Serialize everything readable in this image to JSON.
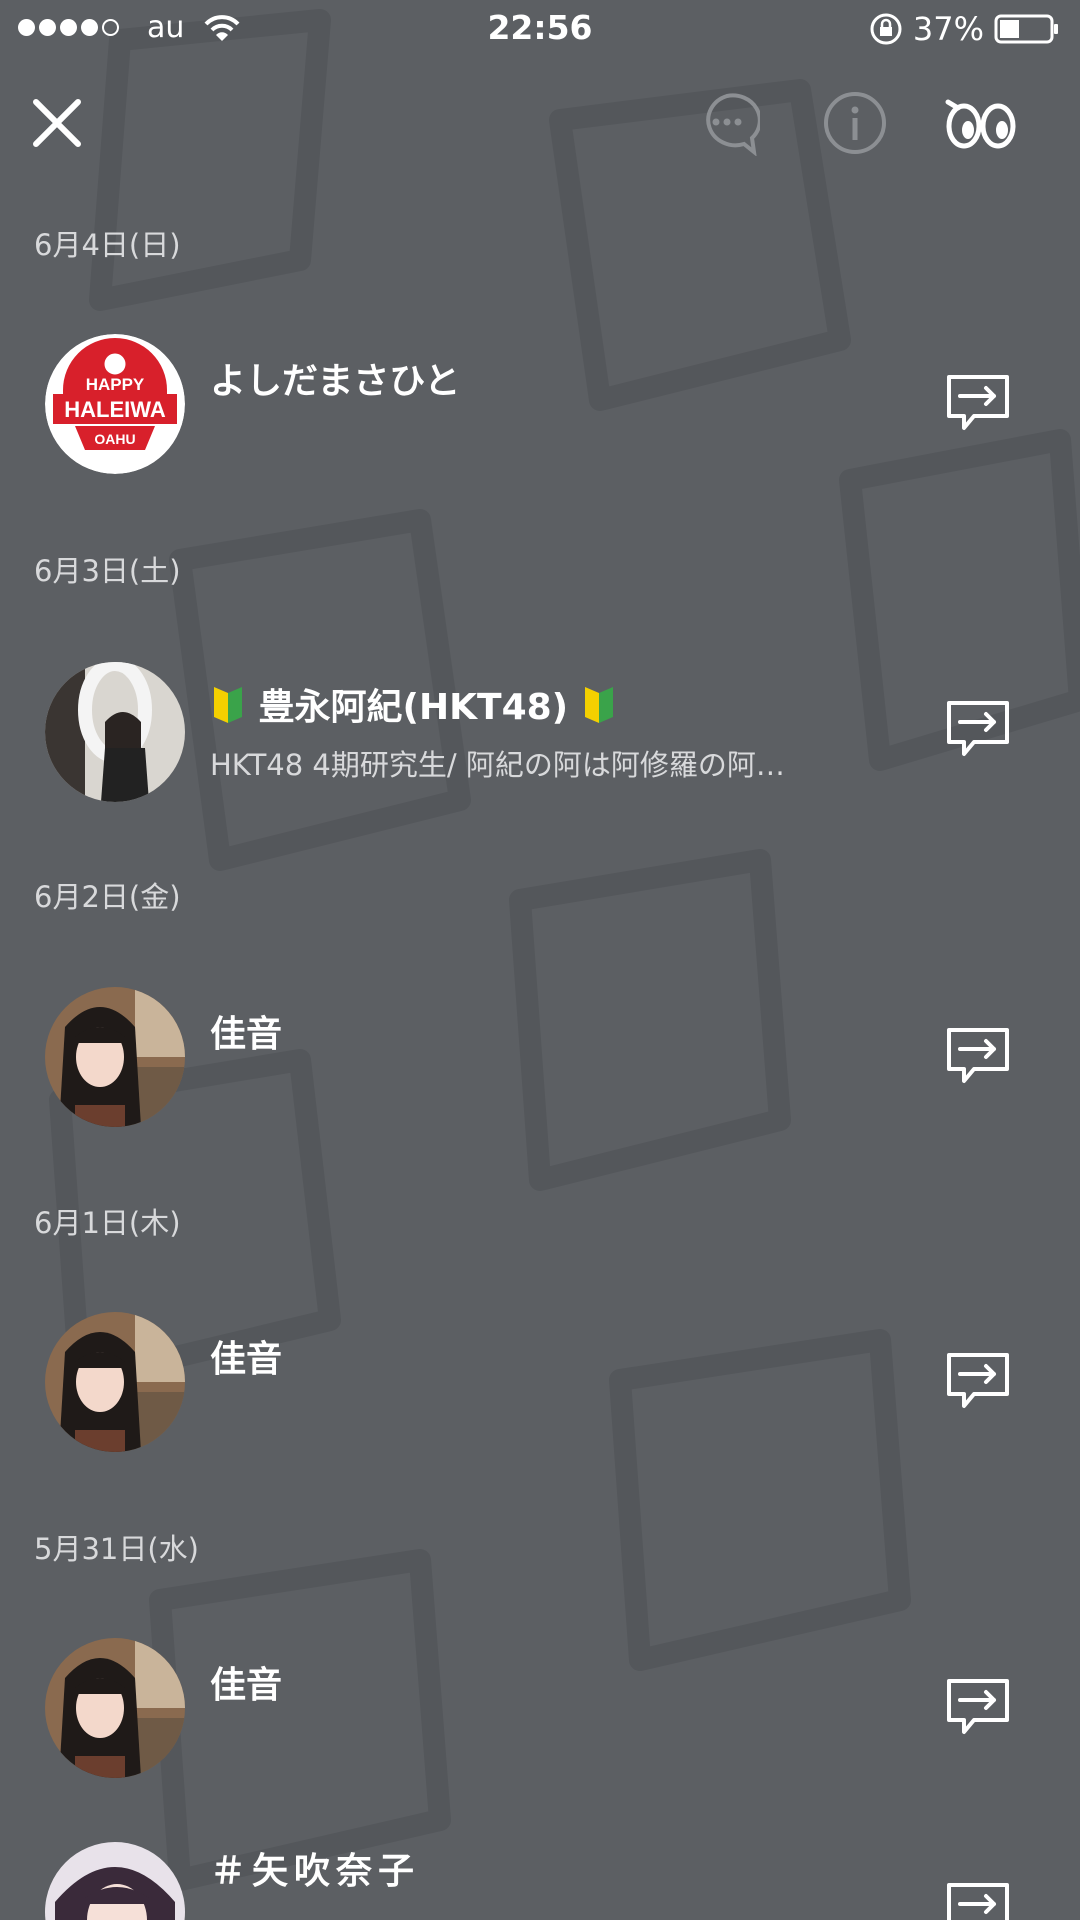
{
  "status_bar": {
    "carrier": "au",
    "time": "22:56",
    "battery": "37%"
  },
  "header": {
    "close_icon": "close-icon",
    "chat_icon": "chat-bubble-icon",
    "info_icon": "info-icon",
    "eyes_icon": "eyes-icon"
  },
  "sections": [
    {
      "date": "6月4日(日)",
      "name": "よしだまさひと",
      "subtitle": ""
    },
    {
      "date": "6月3日(土)",
      "name": "豊永阿紀(HKT48)",
      "subtitle": "HKT48 4期研究生/ 阿紀の阿は阿修羅の阿…"
    },
    {
      "date": "6月2日(金)",
      "name": "佳音",
      "subtitle": ""
    },
    {
      "date": "6月1日(木)",
      "name": "佳音",
      "subtitle": ""
    },
    {
      "date": "5月31日(水)",
      "name": "佳音",
      "subtitle": ""
    },
    {
      "date": "",
      "name": "＃矢吹奈子",
      "subtitle": ""
    }
  ],
  "avatar_logo": {
    "line1": "HAPPY",
    "line2": "HALEIWA",
    "line3": "OAHU"
  },
  "colors": {
    "background": "#5c5f63",
    "text": "#ffffff",
    "secondary_text": "#d8d9db",
    "logo_red": "#d8202b"
  }
}
